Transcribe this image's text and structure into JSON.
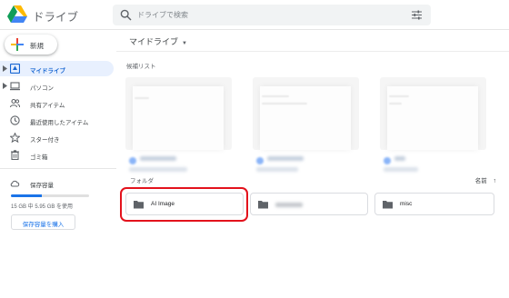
{
  "header": {
    "app_title": "ドライブ",
    "search_placeholder": "ドライブで検索",
    "icons": [
      "drive-logo",
      "search-icon",
      "tune-icon"
    ]
  },
  "sidebar": {
    "new_label": "新規",
    "items": [
      {
        "label": "マイドライブ",
        "icon": "my-drive-icon",
        "active": true,
        "expandable": true
      },
      {
        "label": "パソコン",
        "icon": "computer-icon",
        "active": false,
        "expandable": true
      },
      {
        "label": "共有アイテム",
        "icon": "shared-icon",
        "active": false,
        "expandable": false
      },
      {
        "label": "最近使用したアイテム",
        "icon": "clock-icon",
        "active": false,
        "expandable": false
      },
      {
        "label": "スター付き",
        "icon": "star-icon",
        "active": false,
        "expandable": false
      },
      {
        "label": "ゴミ箱",
        "icon": "trash-icon",
        "active": false,
        "expandable": false
      }
    ],
    "storage": {
      "label": "保存容量",
      "usage_text": "15 GB 中 5.95 GB を使用",
      "used_fraction": 0.4,
      "buy_label": "保存容量を購入"
    }
  },
  "main": {
    "breadcrumb": "マイドライブ",
    "suggested_label": "候補リスト",
    "folders_label": "フォルダ",
    "sort_label": "名前",
    "folders": [
      {
        "name": "AI Image",
        "blurred": false,
        "highlighted": true
      },
      {
        "name": "",
        "blurred": true,
        "highlighted": false
      },
      {
        "name": "misc",
        "blurred": false,
        "highlighted": false
      }
    ]
  },
  "colors": {
    "accent": "#1a73e8",
    "active_bg": "#e8f0fe",
    "highlight": "#e3121c"
  }
}
